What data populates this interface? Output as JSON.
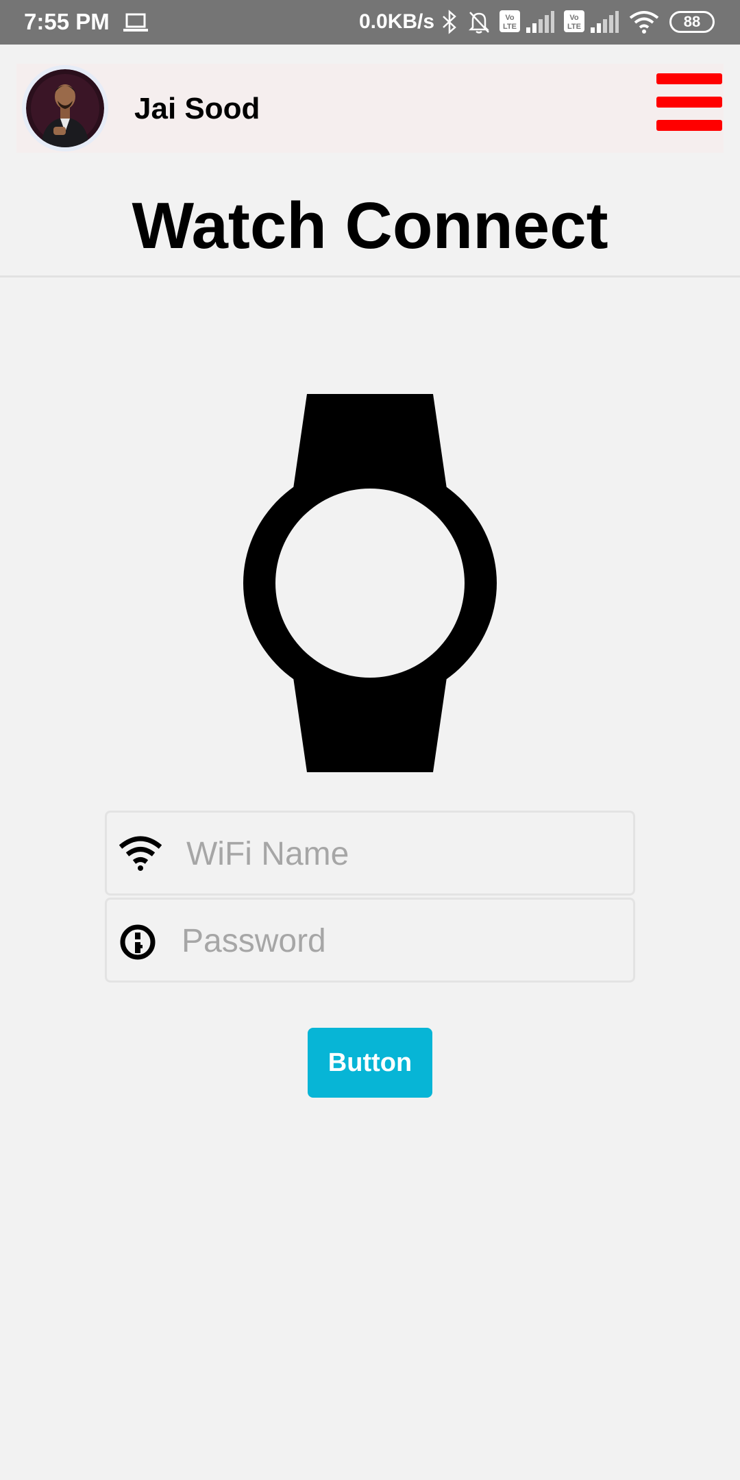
{
  "status_bar": {
    "time": "7:55 PM",
    "network_speed": "0.0KB/s",
    "battery": "88",
    "sim_label": "Vo LTE"
  },
  "header": {
    "user_name": "Jai Sood",
    "menu_color": "#ff0000"
  },
  "page": {
    "title": "Watch Connect"
  },
  "form": {
    "wifi_placeholder": "WiFi Name",
    "wifi_value": "",
    "password_placeholder": "Password",
    "password_value": "",
    "submit_label": "Button",
    "submit_color": "#07b5d6"
  },
  "icons": {
    "status": [
      "laptop-icon",
      "bluetooth-icon",
      "bell-off-icon",
      "volte-icon",
      "signal-icon",
      "wifi-icon",
      "battery-icon"
    ],
    "header": [
      "avatar",
      "hamburger-menu-icon"
    ],
    "main": [
      "watch-icon",
      "wifi-icon",
      "key-icon"
    ]
  }
}
